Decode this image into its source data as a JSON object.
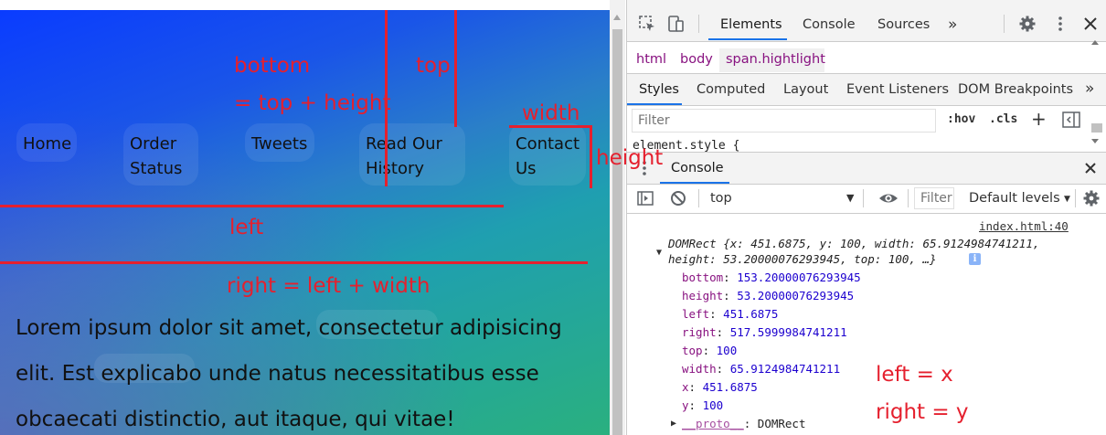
{
  "webpage": {
    "nav": [
      "Home",
      "Order",
      "Status",
      "Tweets",
      "Read Our",
      "History",
      "Contact",
      "Us"
    ],
    "annotations": {
      "bottom": "bottom",
      "bottom_formula": "= top + height",
      "top": "top",
      "width": "width",
      "height": "height",
      "left": "left",
      "right_formula": "right = left + width",
      "left_eq_x": "left = x",
      "right_eq_y": "right = y"
    },
    "lorem": [
      "Lorem ipsum dolor sit amet, consectetur adipisicing",
      "elit. Est explicabo unde natus necessitatibus esse",
      "obcaecati distinctio, aut itaque, qui vitae!"
    ],
    "accent_color": "#e5202e"
  },
  "devtools": {
    "main_tabs": [
      "Elements",
      "Console",
      "Sources",
      "»"
    ],
    "breadcrumb": [
      "html",
      "body",
      "span.hightlight"
    ],
    "style_tabs": [
      "Styles",
      "Computed",
      "Layout",
      "Event Listeners",
      "DOM Breakpoints",
      "»"
    ],
    "styles_filter_placeholder": "Filter",
    "hov": ":hov",
    "cls": ".cls",
    "element_style": "element.style {",
    "drawer_title": "Console",
    "context": "top",
    "console_filter_placeholder": "Filter",
    "levels": "Default levels",
    "source_link": "index.html:40",
    "domrect_summary_1": "DOMRect {x: 451.6875, y: 100, width: 65.9124984741211,",
    "domrect_summary_2": "height: 53.20000076293945, top: 100, …}",
    "props": [
      {
        "key": "bottom",
        "value": "153.20000076293945"
      },
      {
        "key": "height",
        "value": "53.20000076293945"
      },
      {
        "key": "left",
        "value": "451.6875"
      },
      {
        "key": "right",
        "value": "517.5999984741211"
      },
      {
        "key": "top",
        "value": "100"
      },
      {
        "key": "width",
        "value": "65.9124984741211"
      },
      {
        "key": "x",
        "value": "451.6875"
      },
      {
        "key": "y",
        "value": "100"
      }
    ],
    "proto_key": "__proto__",
    "proto_value": "DOMRect"
  }
}
